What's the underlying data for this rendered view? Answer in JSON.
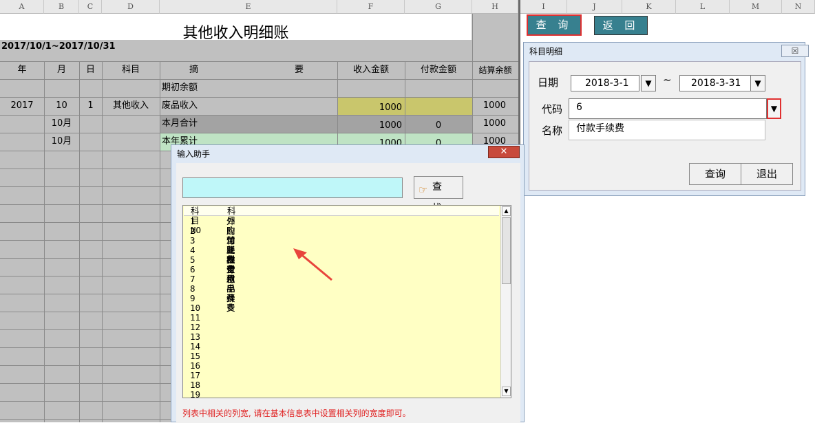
{
  "column_headers": [
    "A",
    "B",
    "C",
    "D",
    "E",
    "F",
    "G",
    "H",
    "I",
    "J",
    "K",
    "L",
    "M",
    "N"
  ],
  "sheet": {
    "title": "其他收入明细账",
    "date_range": "2017/10/1~2017/10/31",
    "headers": {
      "year": "年",
      "month": "月",
      "day": "日",
      "account": "科目",
      "summary_a": "摘",
      "summary_b": "要",
      "income": "收入金额",
      "payment": "付款金额",
      "balance": "结算余额"
    },
    "rows": [
      {
        "year": "",
        "month": "",
        "day": "",
        "account": "",
        "summary": "期初余额",
        "income": "",
        "payment": "",
        "balance": ""
      },
      {
        "year": "2017",
        "month": "10",
        "day": "1",
        "account": "其他收入",
        "summary": "废品收入",
        "income": "1000",
        "payment": "",
        "balance": "1000"
      },
      {
        "year": "",
        "month": "10月",
        "day": "",
        "account": "",
        "summary": "本月合计",
        "income": "1000",
        "payment": "0",
        "balance": "1000"
      },
      {
        "year": "",
        "month": "10月",
        "day": "",
        "account": "",
        "summary": "本年累计",
        "income": "1000",
        "payment": "0",
        "balance": "1000"
      }
    ],
    "colors": {
      "income_highlight": "#c9c66c",
      "month_total": "#a3a3a3",
      "year_total": "#bfe3c4"
    }
  },
  "buttons": {
    "query": "查 询",
    "return": "返 回"
  },
  "detail_dialog": {
    "title": "科目明细",
    "close": "☒",
    "date_label": "日期",
    "date_from": "2018-3-1",
    "tilde": "~",
    "date_to": "2018-3-31",
    "code_label": "代码",
    "code_value": "6",
    "name_label": "名称",
    "name_value": "付款手续费",
    "query_btn": "查询",
    "exit_btn": "退出"
  },
  "helper_dialog": {
    "title": "输入助手",
    "close": "✕",
    "search_value": "",
    "find_btn": "查 找",
    "list_header": {
      "no": "科目NO",
      "name": "科目"
    },
    "items": [
      {
        "no": "1",
        "name": "外购加工费"
      },
      {
        "no": "2",
        "name": "应付账款支付"
      },
      {
        "no": "3",
        "name": "营业税金"
      },
      {
        "no": "4",
        "name": "耗材费"
      },
      {
        "no": "5",
        "name": "办公用品开支"
      },
      {
        "no": "6",
        "name": "付款手续费"
      },
      {
        "no": "7",
        "name": "水电费"
      },
      {
        "no": "8",
        "name": ""
      },
      {
        "no": "9",
        "name": ""
      },
      {
        "no": "10",
        "name": ""
      },
      {
        "no": "11",
        "name": ""
      },
      {
        "no": "12",
        "name": ""
      },
      {
        "no": "13",
        "name": ""
      },
      {
        "no": "14",
        "name": ""
      },
      {
        "no": "15",
        "name": ""
      },
      {
        "no": "16",
        "name": ""
      },
      {
        "no": "17",
        "name": ""
      },
      {
        "no": "18",
        "name": ""
      },
      {
        "no": "19",
        "name": ""
      }
    ],
    "hint": "列表中相关的列宽, 请在基本信息表中设置相关列的宽度即可。"
  },
  "icons": {
    "dropdown": "▼",
    "scroll_up": "▲",
    "scroll_down": "▼",
    "find": "☞"
  },
  "annotation_color": "#e8453c"
}
